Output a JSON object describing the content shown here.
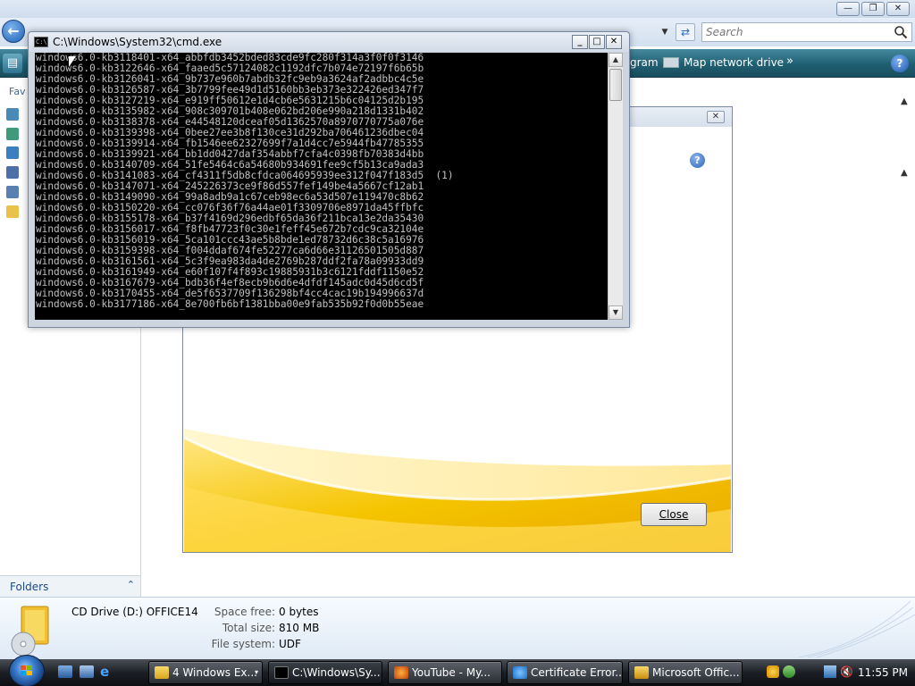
{
  "explorer": {
    "search_placeholder": "Search",
    "toolbar": {
      "program_label": "gram",
      "map_network_label": "Map network drive",
      "more_label": "»"
    },
    "favorites_label": "Fav",
    "folders_label": "Folders",
    "details": {
      "drive_name": "CD Drive (D:) OFFICE14",
      "space_free_label": "Space free:",
      "space_free_value": "0 bytes",
      "total_size_label": "Total size:",
      "total_size_value": "810 MB",
      "file_system_label": "File system:",
      "file_system_value": "UDF"
    }
  },
  "office_dialog": {
    "close_button": "Close"
  },
  "cmd": {
    "title": "C:\\Windows\\System32\\cmd.exe",
    "lines": [
      "windows6.0-kb3118401-x64_abbfdb3452bded83cde9fc280f314a3f0f0f3146",
      "windows6.0-kb3122646-x64_faaed5c57124082c1192dfc7b074e72197f6b65b",
      "windows6.0-kb3126041-x64_9b737e960b7abdb32fc9eb9a3624af2adbbc4c5e",
      "windows6.0-kb3126587-x64_3b7799fee49d1d5160bb3eb373e322426ed347f7",
      "windows6.0-kb3127219-x64_e919ff50612e1d4cb6e5631215b6c04125d2b195",
      "windows6.0-kb3135982-x64_908c309701b408e062bd206e990a218d1331b402",
      "windows6.0-kb3138378-x64_e44548120dceaf05d1362570a8970770775a076e",
      "windows6.0-kb3139398-x64_0bee27ee3b8f130ce31d292ba706461236dbec04",
      "windows6.0-kb3139914-x64_fb1546ee62327699f7a1d4cc7e5944fb47785355",
      "windows6.0-kb3139921-x64_bb1dd0427daf354abbf7cfa4c0398fb70383d4bb",
      "windows6.0-kb3140709-x64_51fe5464c6a54680b934691fee9cf5b13ca9ada3",
      "windows6.0-kb3141083-x64_cf4311f5db8cfdca064695939ee312f047f183d5  (1)",
      "windows6.0-kb3147071-x64_245226373ce9f86d557fef149be4a5667cf12ab1",
      "windows6.0-kb3149090-x64_99a8adb9a1c67ceb98ec6a53d507e119470c8b62",
      "windows6.0-kb3150220-x64_cc076f36f76a44ae01f3309706e8971da45ffbfc",
      "windows6.0-kb3155178-x64_b37f4169d296edbf65da36f211bca13e2da35430",
      "windows6.0-kb3156017-x64_f8fb47723f0c30e1feff45e672b7cdc9ca32104e",
      "windows6.0-kb3156019-x64_5ca101ccc43ae5b8bde1ed78732d6c38c5a16976",
      "windows6.0-kb3159398-x64_f004ddaf674fe52277ca6d66e31126501505d887",
      "windows6.0-kb3161561-x64_5c3f9ea983da4de2769b287ddf2fa78a09933dd9",
      "windows6.0-kb3161949-x64_e60f107f4f893c19885931b3c6121fddf1150e52",
      "windows6.0-kb3167679-x64_bdb36f4ef8ecb9b6d6e4dfdf145adc0d45d6cd5f",
      "windows6.0-kb3170455-x64_de5f6537709f136298bf4cc4cac19b194996637d",
      "windows6.0-kb3177186-x64_8e700fb6bf1381bba00e9fab535b92f0d0b55eae"
    ]
  },
  "taskbar": {
    "items": [
      {
        "label": "4 Windows Ex...",
        "icon": "folder-icon",
        "count_glyph": "▾"
      },
      {
        "label": "C:\\Windows\\Sy...",
        "icon": "cmd-icon"
      },
      {
        "label": "YouTube - My...",
        "icon": "firefox-icon"
      },
      {
        "label": "Certificate Error...",
        "icon": "ie-icon"
      },
      {
        "label": "Microsoft Offic...",
        "icon": "office-setup-icon"
      }
    ],
    "clock": "11:55 PM"
  },
  "colors": {
    "toolbar_teal": "#1f5f72",
    "console_bg": "#000000",
    "console_text": "#c0c0c0",
    "office_gold": "#f5c400"
  }
}
